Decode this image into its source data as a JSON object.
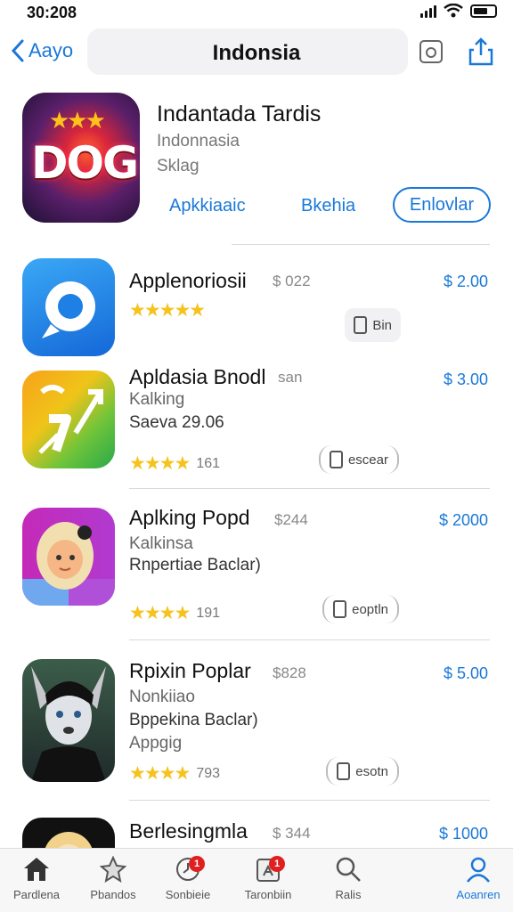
{
  "status": {
    "time": "30:208"
  },
  "nav": {
    "back_label": "Aayo",
    "title": "Indonsia"
  },
  "hero": {
    "icon_text": "DOG",
    "title": "Indantada Tardis",
    "subtitle1": "Indonnasia",
    "subtitle2": "Sklag",
    "link1": "Apkkiaaic",
    "link2": "Bkehia",
    "button": "Enlovlar"
  },
  "apps": [
    {
      "name": "Applenoriosii",
      "inline_price": "$ 022",
      "price": "$ 2.00",
      "line1": "",
      "line2": "",
      "line3": "",
      "stars": "★★★★★",
      "count": "",
      "action": "Bin",
      "icon": "chat-icon"
    },
    {
      "name": "Apldasia Bnodl",
      "inline_price": "san",
      "price": "$ 3.00",
      "line1": "Kalking",
      "line2": "Saeva 29.06",
      "line3": "",
      "stars": "★★★★",
      "count": "161",
      "action": "escear",
      "icon": "arrows-icon"
    },
    {
      "name": "Aplking Popd",
      "inline_price": "$244",
      "price": "$ 2000",
      "line1": "Kalkinsa",
      "line2": "Rnpertiae Baclar)",
      "line3": "",
      "stars": "★★★★",
      "count": "191",
      "action": "eoptln",
      "icon": "girl-avatar-icon"
    },
    {
      "name": "Rpixin Poplar",
      "inline_price": "$828",
      "price": "$ 5.00",
      "line1": "Nonkiiao",
      "line2": "Bppekina Baclar)",
      "line3": "Appgig",
      "stars": "★★★★",
      "count": "793",
      "action": "esotn",
      "icon": "wolf-avatar-icon"
    },
    {
      "name": "Berlesingmla",
      "inline_price": "$ 344",
      "price": "$ 1000",
      "line1": "",
      "line2": "",
      "line3": "",
      "stars": "",
      "count": "",
      "action": "",
      "icon": "cartoon-icon"
    }
  ],
  "tabs": [
    {
      "label": "Pardlena",
      "icon": "home-icon",
      "badge": ""
    },
    {
      "label": "Pbandos",
      "icon": "star-icon",
      "badge": ""
    },
    {
      "label": "Sonbieie",
      "icon": "clock-icon",
      "badge": "1"
    },
    {
      "label": "Taronbiin",
      "icon": "app-store-icon",
      "badge": "1"
    },
    {
      "label": "Ralis",
      "icon": "search-icon",
      "badge": ""
    },
    {
      "label": "Aoanren",
      "icon": "profile-icon",
      "badge": ""
    }
  ],
  "colors": {
    "accent": "#1a78d8",
    "star": "#f6c21d",
    "badge": "#e02020"
  }
}
